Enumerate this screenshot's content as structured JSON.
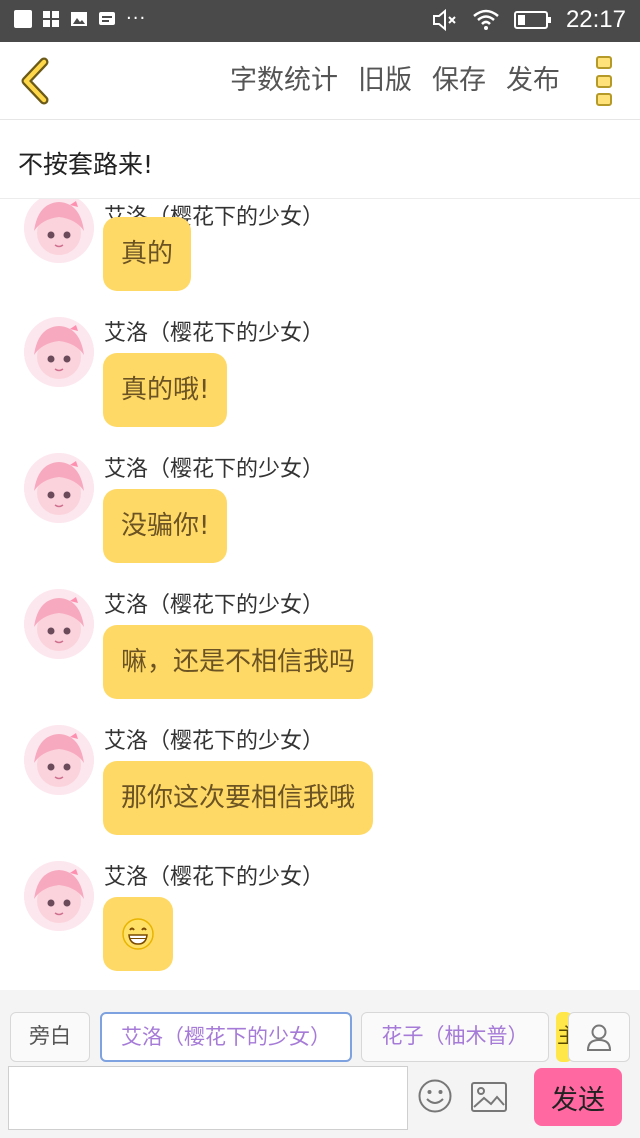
{
  "status_bar": {
    "time": "22:17",
    "more_dots": "···"
  },
  "toolbar": {
    "actions": [
      "字数统计",
      "旧版",
      "保存",
      "发布"
    ]
  },
  "story": {
    "title": "不按套路来!"
  },
  "messages": [
    {
      "sender": "艾洛（樱花下的少女）",
      "text": "真的"
    },
    {
      "sender": "艾洛（樱花下的少女）",
      "text": "真的哦!"
    },
    {
      "sender": "艾洛（樱花下的少女）",
      "text": "没骗你!"
    },
    {
      "sender": "艾洛（樱花下的少女）",
      "text": "嘛，还是不相信我吗"
    },
    {
      "sender": "艾洛（樱花下的少女）",
      "text": "那你这次要相信我哦"
    },
    {
      "sender": "艾洛（樱花下的少女）",
      "text": "",
      "emoji": "grinning-face"
    }
  ],
  "roles": {
    "narrator": "旁白",
    "selected": "艾洛（樱花下的少女）",
    "other": "花子（柚木普）",
    "partial": "主"
  },
  "composer": {
    "input_value": "",
    "send_label": "发送"
  },
  "colors": {
    "bubble": "#ffd966",
    "send_button": "#ff68a1",
    "role_text": "#a67bd8",
    "status_bar": "#4a4a4a"
  }
}
